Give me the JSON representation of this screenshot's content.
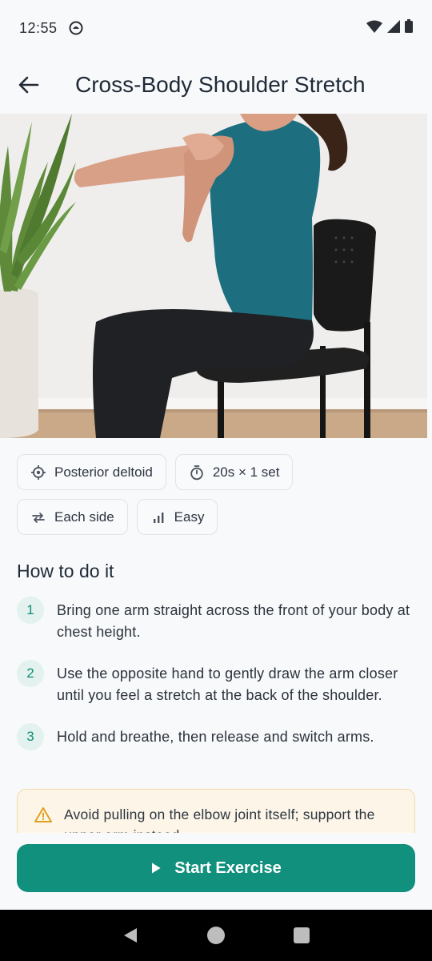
{
  "status": {
    "time": "12:55"
  },
  "header": {
    "title": "Cross-Body Shoulder Stretch",
    "back_icon": "arrow-left-icon"
  },
  "hero": {
    "alt": "Woman seated on a black chair stretching one arm across her chest"
  },
  "chips": [
    {
      "icon": "target-icon",
      "label": "Posterior deltoid"
    },
    {
      "icon": "timer-icon",
      "label": "20s × 1 set"
    },
    {
      "icon": "swap-arrows-icon",
      "label": "Each side"
    },
    {
      "icon": "bar-chart-icon",
      "label": "Easy"
    }
  ],
  "how_to": {
    "title": "How to do it",
    "steps": [
      {
        "number": "1",
        "text": "Bring one arm straight across the front of your body at chest height."
      },
      {
        "number": "2",
        "text": "Use the opposite hand to gently draw the arm closer until you feel a stretch at the back of the shoulder."
      },
      {
        "number": "3",
        "text": "Hold and breathe, then release and switch arms."
      }
    ]
  },
  "warning": {
    "icon": "warning-triangle-icon",
    "text": "Avoid pulling on the elbow joint itself; support the upper arm instead."
  },
  "action": {
    "start_label": "Start Exercise",
    "icon": "play-icon"
  },
  "colors": {
    "accent": "#12907e",
    "accent_light": "#e3f2ee",
    "warning_bg": "#fdf6e8",
    "warning_border": "#f4d9a6",
    "warning_icon": "#e0a020"
  }
}
